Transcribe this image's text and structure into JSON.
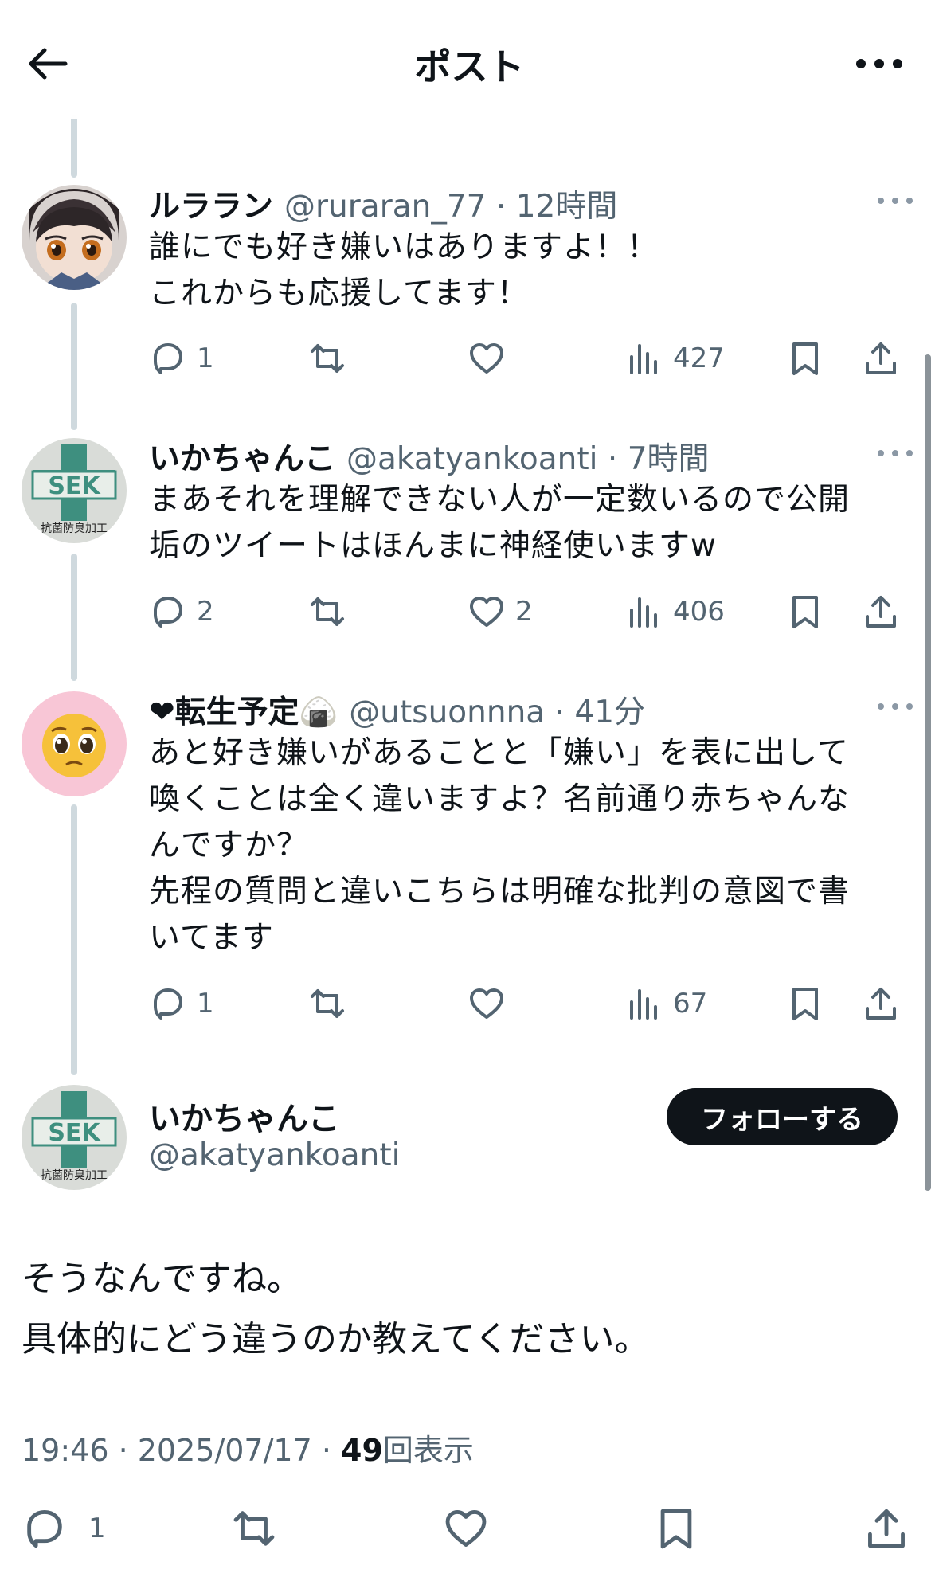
{
  "header": {
    "title": "ポスト",
    "back_icon": "arrow-left-icon",
    "more_icon": "more-horizontal-icon"
  },
  "replies": [
    {
      "name": "ルララン",
      "handle": "@ruraran_77",
      "dot": " · ",
      "time": "12時間",
      "text": "誰にでも好き嫌いはありますよ！！\nこれからも応援してます！",
      "reply_count": "1",
      "repost_count": "",
      "like_count": "",
      "view_count": "427"
    },
    {
      "name": "いかちゃんこ",
      "handle": "@akatyankoanti",
      "dot": " · ",
      "time": "7時間",
      "text": "まあそれを理解できない人が一定数いるので公開\n垢のツイートはほんまに神経使いますw",
      "reply_count": "2",
      "repost_count": "",
      "like_count": "2",
      "view_count": "406"
    },
    {
      "name": "❤︎転生予定🍙",
      "handle": "@utsuonnna",
      "dot": " · ",
      "time": "41分",
      "text": "あと好き嫌いがあることと「嫌い」を表に出して\n喚くことは全く違いますよ？名前通り赤ちゃんな\nんですか？\n先程の質問と違いこちらは明確な批判の意図で書\nいてます",
      "reply_count": "1",
      "repost_count": "",
      "like_count": "",
      "view_count": "67"
    }
  ],
  "main_post": {
    "name": "いかちゃんこ",
    "handle": "@akatyankoanti",
    "follow_label": "フォローする",
    "text": "そうなんですね。\n具体的にどう違うのか教えてください。",
    "timestamp": "19:46 · 2025/07/17 · ",
    "views": "49",
    "views_label": "回表示",
    "reply_count": "1"
  },
  "avatar_texts": {
    "sek": "SEK",
    "sek_caption": "抗菌防臭加工"
  },
  "colors": {
    "text": "#0f1419",
    "secondary": "#536471",
    "line": "#cfd9de",
    "follow_bg": "#0f1419",
    "sek_green": "#3e8f7f"
  }
}
